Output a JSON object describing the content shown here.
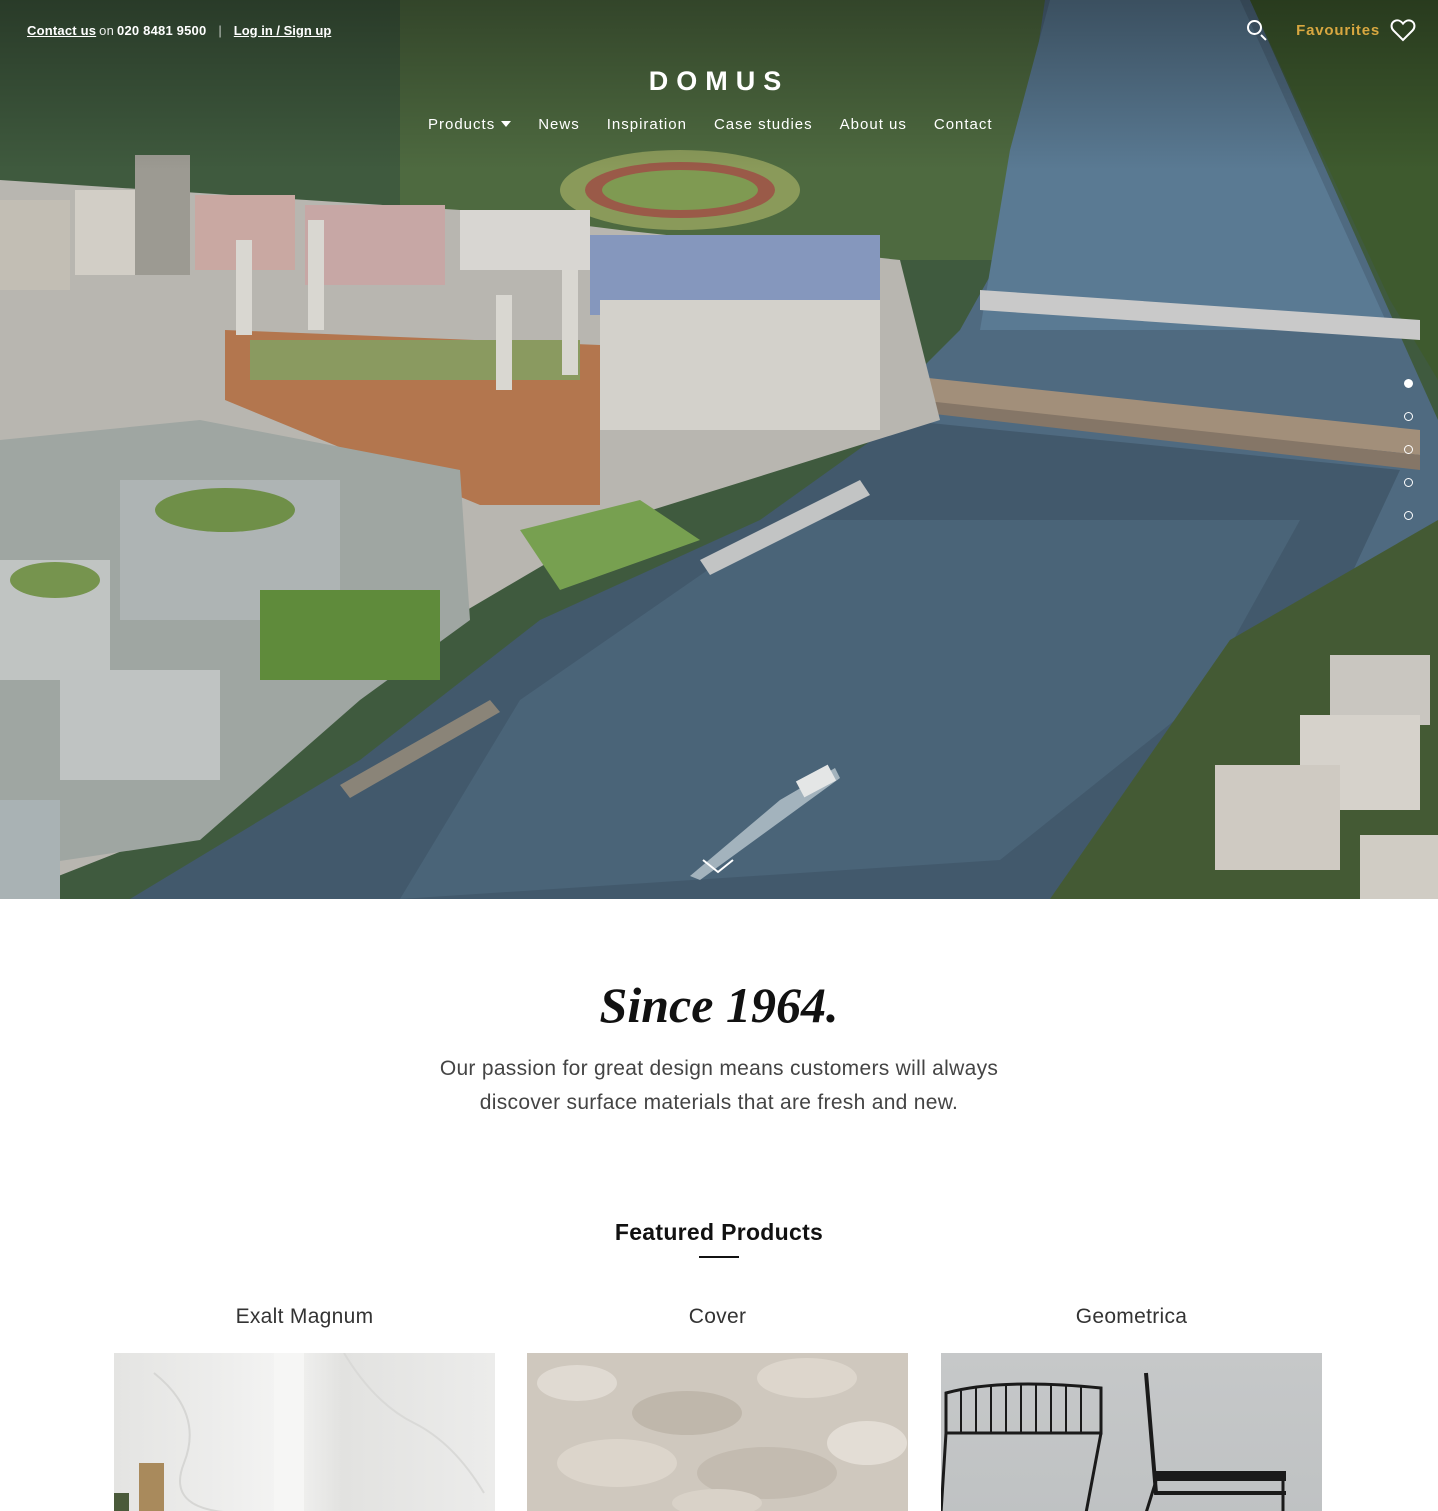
{
  "topbar": {
    "contact_link": "Contact us",
    "contact_on": "on",
    "phone": "020 8481 9500",
    "separator": "|",
    "login": "Log in / Sign up",
    "favourites": "Favourites"
  },
  "brand": {
    "logo": "DOMUS"
  },
  "nav": {
    "items": [
      {
        "label": "Products",
        "has_dropdown": true
      },
      {
        "label": "News"
      },
      {
        "label": "Inspiration"
      },
      {
        "label": "Case studies"
      },
      {
        "label": "About us"
      },
      {
        "label": "Contact"
      }
    ]
  },
  "hero": {
    "slides_total": 5,
    "active_slide": 1
  },
  "intro": {
    "heading": "Since 1964.",
    "tagline_line1": "Our passion for great design means customers will always",
    "tagline_line2": "discover surface materials that are fresh and new."
  },
  "featured": {
    "title": "Featured Products",
    "products": [
      {
        "name": "Exalt Magnum"
      },
      {
        "name": "Cover"
      },
      {
        "name": "Geometrica"
      }
    ]
  },
  "colors": {
    "accent_gold": "#d8a740",
    "text_dark": "#111111",
    "text_body": "#444444"
  },
  "icons": [
    "search-icon",
    "heart-icon",
    "chevron-down-icon",
    "caret-down-icon"
  ]
}
